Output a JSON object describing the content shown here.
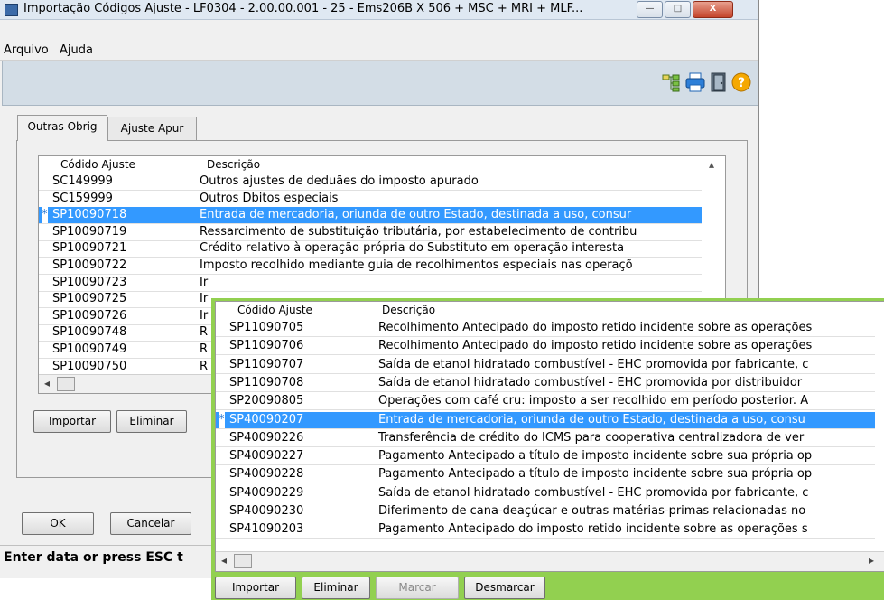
{
  "window": {
    "title": "Importação Códigos Ajuste - LF0304 - 2.00.00.001 - 25 - Ems206B X 506 + MSC + MRI + MLF...",
    "minimize_glyph": "—",
    "maximize_glyph": "□",
    "close_glyph": "X"
  },
  "menu": {
    "items": [
      "Arquivo",
      "Ajuda"
    ]
  },
  "toolbar": {
    "icons": [
      "tree-structure-icon",
      "printer-icon",
      "exit-door-icon",
      "help-icon"
    ],
    "help_glyph": "?"
  },
  "tabs": [
    {
      "label": "Outras Obrig",
      "active": true
    },
    {
      "label": "Ajuste Apur",
      "active": false
    }
  ],
  "main_grid": {
    "columns": [
      "Códido Ajuste",
      "Descrição"
    ],
    "rows": [
      {
        "code": "SC149999",
        "desc": "Outros ajustes de deduães do imposto apurado",
        "selected": false
      },
      {
        "code": "SC159999",
        "desc": "Outros Dbitos especiais",
        "selected": false
      },
      {
        "code": "SP10090718",
        "desc": "Entrada de mercadoria, oriunda de outro Estado, destinada a uso, consur",
        "selected": true
      },
      {
        "code": "SP10090719",
        "desc": "Ressarcimento de substituição tributária, por estabelecimento de contribu",
        "selected": false
      },
      {
        "code": "SP10090721",
        "desc": "Crédito relativo à operação própria do Substituto  em operação interesta",
        "selected": false
      },
      {
        "code": "SP10090722",
        "desc": "Imposto recolhido mediante guia de recolhimentos especiais nas operaçõ",
        "selected": false
      },
      {
        "code": "SP10090723",
        "desc": "Ir",
        "selected": false
      },
      {
        "code": "SP10090725",
        "desc": "Ir",
        "selected": false
      },
      {
        "code": "SP10090726",
        "desc": "Ir",
        "selected": false
      },
      {
        "code": "SP10090748",
        "desc": "R",
        "selected": false
      },
      {
        "code": "SP10090749",
        "desc": "R",
        "selected": false
      },
      {
        "code": "SP10090750",
        "desc": "R",
        "selected": false
      }
    ],
    "selected_marker": "*"
  },
  "main_buttons": [
    "Importar",
    "Eliminar"
  ],
  "footer_buttons": [
    "OK",
    "Cancelar"
  ],
  "status": "Enter data or press ESC t",
  "overlay_grid": {
    "columns": [
      "Códido Ajuste",
      "Descrição"
    ],
    "rows": [
      {
        "code": "SP11090705",
        "desc": "Recolhimento Antecipado do imposto retido incidente sobre as operações",
        "selected": false
      },
      {
        "code": "SP11090706",
        "desc": "Recolhimento Antecipado do imposto retido incidente sobre as operações",
        "selected": false
      },
      {
        "code": "SP11090707",
        "desc": "Saída de etanol hidratado combustível - EHC promovida por fabricante, c",
        "selected": false
      },
      {
        "code": "SP11090708",
        "desc": "Saída de etanol hidratado combustível - EHC promovida por distribuidor",
        "selected": false
      },
      {
        "code": "SP20090805",
        "desc": "Operações com café cru: imposto a ser recolhido em período posterior. A",
        "selected": false
      },
      {
        "code": "SP40090207",
        "desc": "Entrada de mercadoria, oriunda de outro Estado, destinada a uso, consu",
        "selected": true
      },
      {
        "code": "SP40090226",
        "desc": "Transferência de crédito do ICMS para cooperativa centralizadora de ver",
        "selected": false
      },
      {
        "code": "SP40090227",
        "desc": "Pagamento Antecipado a título de imposto incidente sobre sua própria op",
        "selected": false
      },
      {
        "code": "SP40090228",
        "desc": "Pagamento Antecipado a título de imposto incidente sobre sua própria op",
        "selected": false
      },
      {
        "code": "SP40090229",
        "desc": "Saída de etanol hidratado combustível - EHC promovida por fabricante, c",
        "selected": false
      },
      {
        "code": "SP40090230",
        "desc": "Diferimento de cana-deaçúcar e outras matérias-primas relacionadas no",
        "selected": false
      },
      {
        "code": "SP41090203",
        "desc": "Pagamento Antecipado do imposto retido incidente sobre as operações s",
        "selected": false
      }
    ],
    "selected_marker": "*"
  },
  "overlay_buttons": [
    {
      "label": "Importar",
      "enabled": true
    },
    {
      "label": "Eliminar",
      "enabled": true
    },
    {
      "label": "Marcar",
      "enabled": false
    },
    {
      "label": "Desmarcar",
      "enabled": true
    }
  ],
  "scroll_glyphs": {
    "left": "◂",
    "right": "▸",
    "up": "▴"
  }
}
